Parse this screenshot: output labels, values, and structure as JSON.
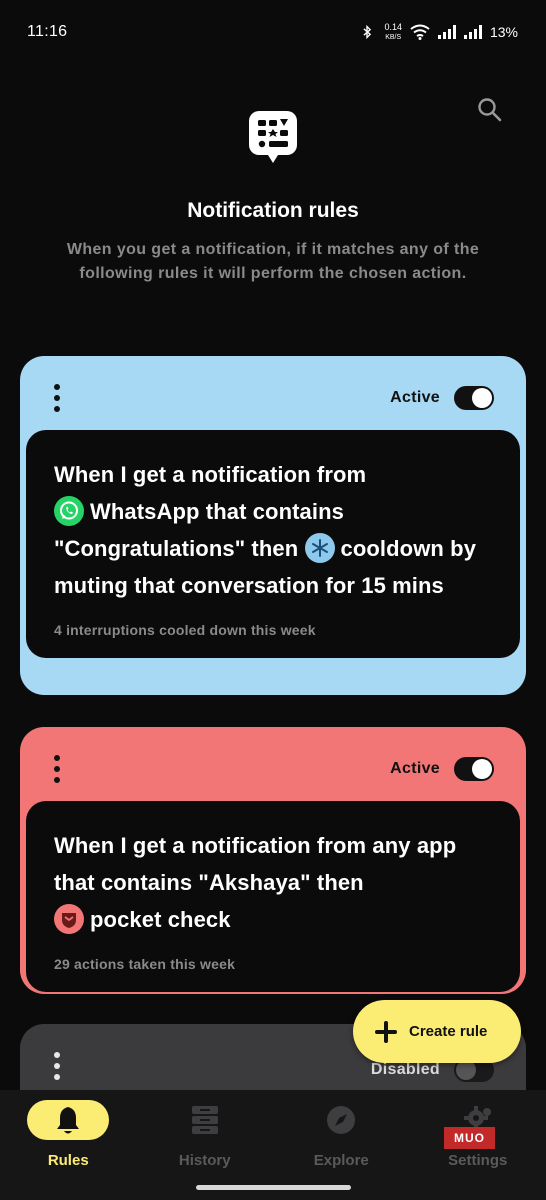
{
  "status_bar": {
    "time": "11:16",
    "speed_value": "0.14",
    "speed_unit": "KB/S",
    "battery": "13%"
  },
  "header": {
    "title": "Notification rules",
    "subtitle": "When you get a notification, if it matches any of the following rules it will perform the chosen action."
  },
  "rules": [
    {
      "status": "Active",
      "enabled": true,
      "text_parts": [
        "When I get a notification from",
        "WhatsApp that contains \"Congratulations\" then",
        "cooldown by muting that conversation for 15 mins"
      ],
      "stats": "4 interruptions cooled down this week",
      "color": "#a7d8f4"
    },
    {
      "status": "Active",
      "enabled": true,
      "text_parts": [
        "When I get a notification from any app that contains \"Akshaya\" then",
        "pocket check"
      ],
      "stats": "29 actions taken this week",
      "color": "#f37676"
    },
    {
      "status": "Disabled",
      "enabled": false,
      "color": "#3b3b3e"
    }
  ],
  "fab": {
    "label": "Create rule"
  },
  "nav": {
    "items": [
      {
        "label": "Rules",
        "icon": "bell-icon",
        "active": true
      },
      {
        "label": "History",
        "icon": "history-icon",
        "active": false
      },
      {
        "label": "Explore",
        "icon": "compass-icon",
        "active": false
      },
      {
        "label": "Settings",
        "icon": "gear-icon",
        "active": false
      }
    ]
  },
  "watermark": "MUO",
  "colors": {
    "accent": "#fbec74",
    "background": "#0b0b0c"
  }
}
